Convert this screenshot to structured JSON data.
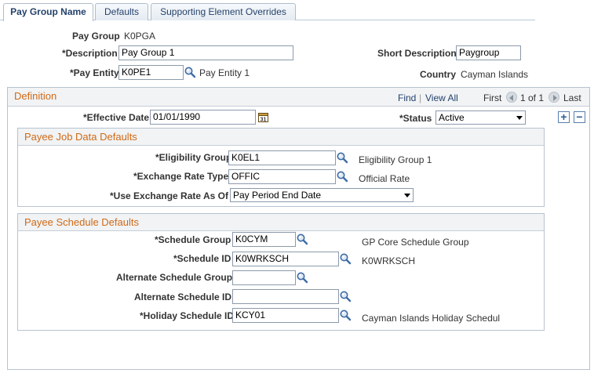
{
  "tabs": [
    {
      "label": "Pay Group Name"
    },
    {
      "label": "Defaults"
    },
    {
      "label": "Supporting Element Overrides"
    }
  ],
  "header": {
    "pay_group_label": "Pay Group",
    "pay_group_value": "K0PGA",
    "description_label": "*Description",
    "description_value": "Pay Group 1",
    "short_description_label": "Short Description",
    "short_description_value": "Paygroup",
    "pay_entity_label": "*Pay Entity",
    "pay_entity_value": "K0PE1",
    "pay_entity_desc": "Pay Entity 1",
    "country_label": "Country",
    "country_value": "Cayman Islands"
  },
  "definition": {
    "title": "Definition",
    "find": "Find",
    "separator": "|",
    "view_all": "View All",
    "first": "First",
    "count": "1 of 1",
    "last": "Last",
    "effective_date_label": "*Effective Date",
    "effective_date_value": "01/01/1990",
    "status_label": "*Status",
    "status_value": "Active",
    "add_symbol": "+",
    "remove_symbol": "−"
  },
  "job_data": {
    "title": "Payee Job Data Defaults",
    "eligibility_group_label": "*Eligibility Group",
    "eligibility_group_value": "K0EL1",
    "eligibility_group_desc": "Eligibility Group 1",
    "exchange_rate_type_label": "*Exchange Rate Type",
    "exchange_rate_type_value": "OFFIC",
    "exchange_rate_type_desc": "Official Rate",
    "use_exchange_rate_label": "*Use Exchange Rate As Of",
    "use_exchange_rate_value": "Pay Period End Date"
  },
  "schedule": {
    "title": "Payee Schedule Defaults",
    "schedule_group_label": "*Schedule Group",
    "schedule_group_value": "K0CYM",
    "schedule_group_desc": "GP Core Schedule Group",
    "schedule_id_label": "*Schedule ID",
    "schedule_id_value": "K0WRKSCH",
    "schedule_id_desc": "K0WRKSCH",
    "alt_schedule_group_label": "Alternate Schedule Group",
    "alt_schedule_group_value": "",
    "alt_schedule_id_label": "Alternate Schedule ID",
    "alt_schedule_id_value": "",
    "holiday_schedule_id_label": "*Holiday Schedule ID",
    "holiday_schedule_id_value": "KCY01",
    "holiday_schedule_id_desc": "Cayman Islands Holiday Schedul"
  },
  "colors": {
    "section_title": "#d06a16",
    "link": "#24426b",
    "border": "#b8c3cf"
  },
  "icons": [
    "lookup-icon",
    "calendar-icon",
    "previous-icon",
    "next-icon",
    "add-row-icon",
    "delete-row-icon",
    "dropdown-arrow-icon"
  ]
}
